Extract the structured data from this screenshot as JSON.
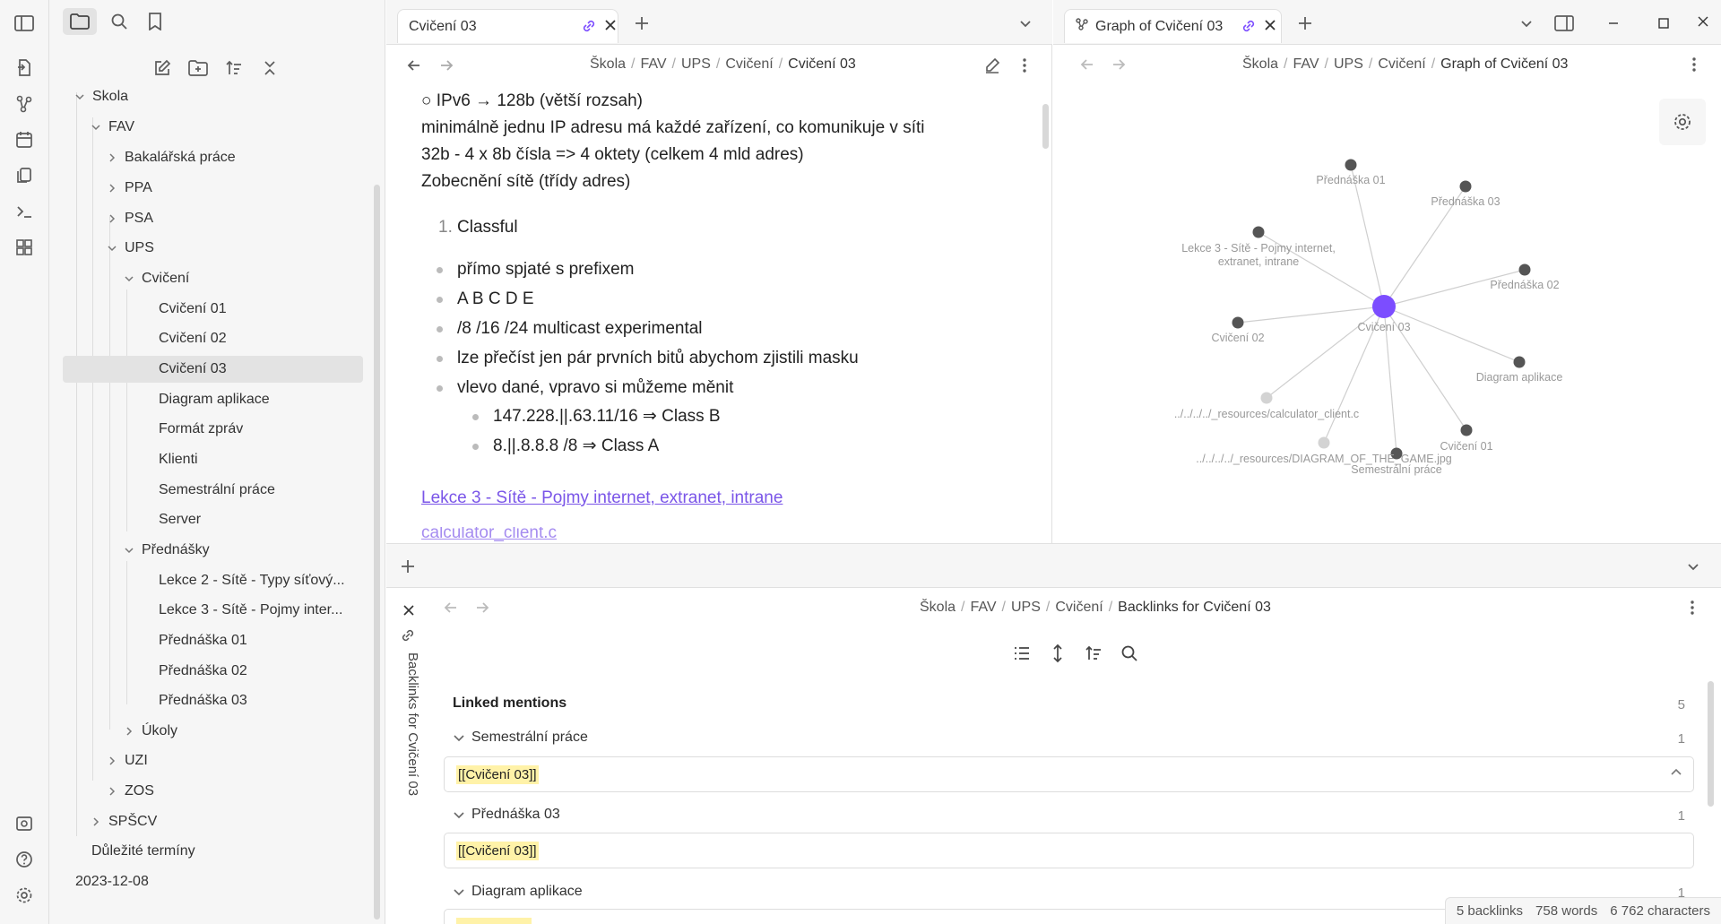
{
  "sidebar": {
    "tree": [
      {
        "label": "Skola",
        "expanded": true
      },
      {
        "label": "FAV",
        "expanded": true
      },
      {
        "label": "Bakalářská práce"
      },
      {
        "label": "PPA"
      },
      {
        "label": "PSA"
      },
      {
        "label": "UPS",
        "expanded": true
      },
      {
        "label": "Cvičení",
        "expanded": true
      },
      {
        "label": "Cvičení 01"
      },
      {
        "label": "Cvičení 02"
      },
      {
        "label": "Cvičení 03",
        "selected": true
      },
      {
        "label": "Diagram aplikace"
      },
      {
        "label": "Formát zpráv"
      },
      {
        "label": "Klienti"
      },
      {
        "label": "Semestrální práce"
      },
      {
        "label": "Server"
      },
      {
        "label": "Přednášky",
        "expanded": true
      },
      {
        "label": "Lekce 2 - Sítě - Typy síťový..."
      },
      {
        "label": "Lekce 3 - Sítě - Pojmy inter..."
      },
      {
        "label": "Přednáška 01"
      },
      {
        "label": "Přednáška 02"
      },
      {
        "label": "Přednáška 03"
      },
      {
        "label": "Úkoly"
      },
      {
        "label": "UZI"
      },
      {
        "label": "ZOS"
      },
      {
        "label": "SPŠCV"
      },
      {
        "label": "Důležité termíny"
      },
      {
        "label": "2023-12-08"
      }
    ]
  },
  "editor": {
    "tab_title": "Cvičení 03",
    "breadcrumb": [
      "Škola",
      "FAV",
      "UPS",
      "Cvičení",
      "Cvičení 03"
    ],
    "lines": {
      "l1": "○ IPv6 → 128b (větší rozsah)",
      "l2": "minimálně jednu IP adresu má každé zařízení, co komunikuje v síti",
      "l3": "32b - 4 x 8b čísla => 4 oktety (celkem 4 mld adres)",
      "l4": "Zobecnění sítě (třídy adres)",
      "ol_num": "1.",
      "ol_text": "Classful",
      "b1": "přímo spjaté s prefixem",
      "b2": "A B C D E",
      "b3": "/8 /16 /24 multicast experimental",
      "b4": "lze přečíst jen pár prvních bitů abychom zjistili masku",
      "b5": "vlevo dané, vpravo si můžeme měnit",
      "s1": "147.228.||.63.11/16 ⇒ Class B",
      "s2": "8.||.8.8.8 /8 ⇒ Class A",
      "link1": "Lekce 3 - Sítě - Pojmy internet, extranet, intrane",
      "link2": "calculator_client.c"
    }
  },
  "graph": {
    "tab_title": "Graph of Cvičení 03",
    "breadcrumb": [
      "Škola",
      "FAV",
      "UPS",
      "Cvičení",
      "Graph of Cvičení 03"
    ],
    "nodes": {
      "n_center": "Cvičení 03",
      "n_pr01": "Přednáška 01",
      "n_pr03": "Přednáška 03",
      "n_lek3a": "Lekce 3 - Sítě - Pojmy internet,",
      "n_lek3b": "extranet, intrane",
      "n_pr02": "Přednáška 02",
      "n_cv02": "Cvičení 02",
      "n_diag": "Diagram aplikace",
      "n_calc": "../../../../_resources/calculator_client.c",
      "n_cv01": "Cvičení 01",
      "n_game": "../../../../_resources/DIAGRAM_OF_THE_GAME.jpg",
      "n_sem": "Semestrální práce"
    },
    "accent": "#7c4dff"
  },
  "backlinks": {
    "vertical_title": "Backlinks for Cvičení 03",
    "breadcrumb": [
      "Škola",
      "FAV",
      "UPS",
      "Cvičení",
      "Backlinks for Cvičení 03"
    ],
    "linked_mentions": "Linked mentions",
    "total": "5",
    "groups": [
      {
        "title": "Semestrální práce",
        "count": "1",
        "snippet": "[[Cvičení 03]]"
      },
      {
        "title": "Přednáška 03",
        "count": "1",
        "snippet": "[[Cvičení 03]]"
      },
      {
        "title": "Diagram aplikace",
        "count": "1",
        "snippet": ""
      }
    ]
  },
  "status": {
    "backlinks": "5 backlinks",
    "words": "758 words",
    "chars": "6 762 characters"
  }
}
